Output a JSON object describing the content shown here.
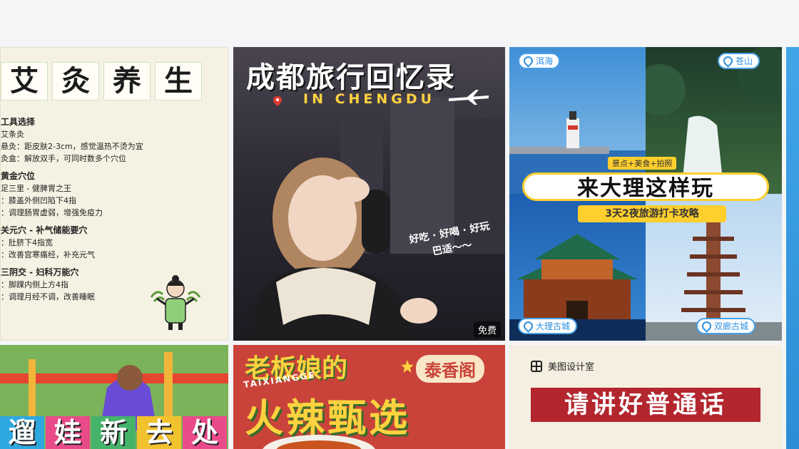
{
  "card1": {
    "title_chars": [
      "艾",
      "灸",
      "养",
      "生"
    ],
    "lines": [
      {
        "text": "工具选择",
        "heading": true
      },
      {
        "text": "艾条灸",
        "heading": false
      },
      {
        "text": "悬灸：距皮肤2-3cm，感觉温热不烫为宜",
        "heading": false
      },
      {
        "text": "灸盒：解放双手，可同时数多个穴位",
        "heading": false
      },
      {
        "text": "黄金穴位",
        "heading": true
      },
      {
        "text": "足三里 - 健脾胃之王",
        "heading": false
      },
      {
        "text": "：膝盖外侧凹陷下4指",
        "heading": false
      },
      {
        "text": "：调理肠胃虚弱，增强免疫力",
        "heading": false
      },
      {
        "text": "关元穴 - 补气储能要穴",
        "heading": true
      },
      {
        "text": "：肚脐下4指宽",
        "heading": false
      },
      {
        "text": "：改善宫寒痛经，补充元气",
        "heading": false
      },
      {
        "text": "三阴交 - 妇科万能穴",
        "heading": true
      },
      {
        "text": "：脚踝内侧上方4指",
        "heading": false
      },
      {
        "text": "：调理月经不调，改善睡眠",
        "heading": false
      }
    ]
  },
  "card2": {
    "title": "成都旅行回忆录",
    "subtitle": "IN CHENGDU",
    "note_line1": "好吃 · 好喝 · 好玩",
    "note_line2": "巴适～～",
    "badge": "免费"
  },
  "card3": {
    "loc_tl": "洱海",
    "loc_tr": "苍山",
    "loc_bl": "大理古城",
    "loc_br": "双廊古城",
    "mini_tag": "景点+美食+拍照",
    "banner": "来大理这样玩",
    "strip": "3天2夜旅游打卡攻略"
  },
  "card4": {
    "title_chars": [
      "遛",
      "娃",
      "新",
      "去",
      "处"
    ]
  },
  "card5": {
    "title_top": "老板娘的",
    "pinyin": "TAIXIANGGE",
    "pill": "泰香阁",
    "title_big": "火辣甄选"
  },
  "card6": {
    "brand": "美图设计室",
    "banner": "请讲好普通话"
  },
  "colors": {
    "card3_accent": "#ffcf2e",
    "card5_bg": "#c9433a",
    "card6_banner": "#b3262e"
  }
}
